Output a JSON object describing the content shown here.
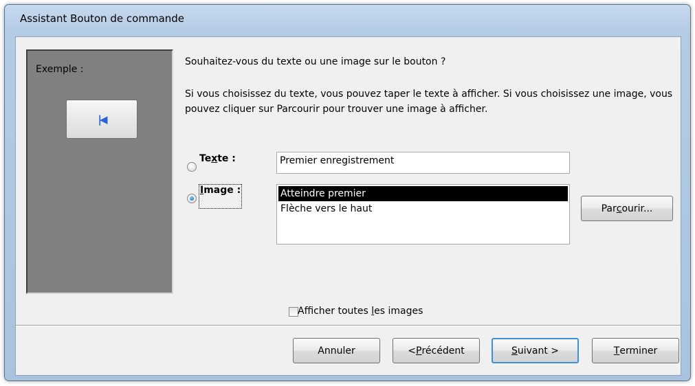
{
  "window": {
    "title": "Assistant Bouton de commande"
  },
  "sample": {
    "label": "Exemple :",
    "button_icon": "first-record-icon"
  },
  "question": "Souhaitez-vous du texte ou une image sur le bouton ?",
  "info": "Si vous choisissez du texte, vous pouvez taper le texte à afficher. Si vous choisissez une image, vous pouvez cliquer sur Parcourir pour trouver une image à afficher.",
  "text_option": {
    "label_pre": "Te",
    "label_key": "x",
    "label_post": "te :",
    "value": "Premier enregistrement",
    "selected": false
  },
  "image_option": {
    "label_key": "I",
    "label_post": "mage :",
    "selected": true,
    "list": [
      "Atteindre premier",
      "Flèche vers le haut"
    ],
    "selected_item": "Atteindre premier"
  },
  "browse_button": {
    "pre": "Par",
    "key": "c",
    "post": "ourir..."
  },
  "show_all_images": {
    "pre": "Afficher toutes ",
    "key": "l",
    "post": "es images",
    "checked": false
  },
  "footer": {
    "cancel": "Annuler",
    "previous": {
      "pre": "< ",
      "key": "P",
      "post": "récédent"
    },
    "next": {
      "key": "S",
      "post": "uivant >"
    },
    "finish": {
      "key": "T",
      "post": "erminer"
    }
  },
  "colors": {
    "title_bar": "#b4cbe4",
    "sample_panel": "#808080",
    "selection": "#000000",
    "default_button_border": "#3c8fd8"
  }
}
